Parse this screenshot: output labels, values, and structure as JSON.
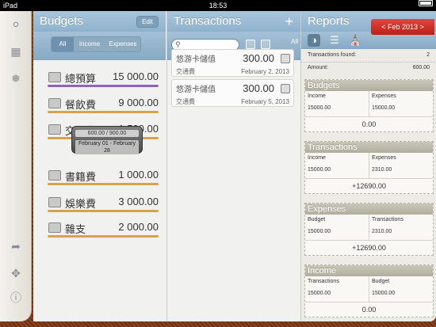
{
  "status": {
    "device": "iPad",
    "time": "18:53"
  },
  "sidebar": {
    "icons": [
      "lock-icon",
      "calculator-icon",
      "settings-icon",
      "share-icon",
      "magic-wand-icon",
      "info-icon"
    ]
  },
  "budgets": {
    "title": "Budgets",
    "edit": "Edit",
    "tabs": [
      "All",
      "Income",
      "Expenses"
    ],
    "items": [
      {
        "name": "總預算",
        "amount": "15 000.00",
        "color": "#8e62c4"
      },
      {
        "name": "餐飲費",
        "amount": "9 000.00",
        "color": "#d6a24a"
      },
      {
        "name": "交通費",
        "amount": "1 500.00",
        "color": "#d6a24a"
      },
      {
        "name": "書籍費",
        "amount": "1 000.00",
        "color": "#d6a24a"
      },
      {
        "name": "娛樂費",
        "amount": "3 000.00",
        "color": "#d6a24a"
      },
      {
        "name": "雜支",
        "amount": "2 000.00",
        "color": "#d6a24a"
      }
    ],
    "tooltip": {
      "used": "600.00 / 900.00",
      "range": "February 01 - February 28"
    }
  },
  "transactions": {
    "title": "Transactions",
    "all": "All",
    "items": [
      {
        "name": "悠游卡儲值",
        "category": "交通費",
        "amount": "300.00",
        "date": "February 2, 2013"
      },
      {
        "name": "悠游卡儲值",
        "category": "交通費",
        "amount": "300.00",
        "date": "February 5, 2013"
      }
    ]
  },
  "reports": {
    "title": "Reports",
    "period": "< Feb 2013 >",
    "found_label": "Transactions found:",
    "found": "2",
    "amount_label": "Amount:",
    "amount": "600.00",
    "sections": [
      {
        "title": "Budgets",
        "l1": "Income",
        "v1": "15000.00",
        "l2": "Expenses",
        "v2": "15000.00",
        "total": "0.00"
      },
      {
        "title": "Transactions",
        "l1": "Income",
        "v1": "15000.00",
        "l2": "Expenses",
        "v2": "2310.00",
        "total": "+12690.00"
      },
      {
        "title": "Expenses",
        "l1": "Budget",
        "v1": "15000.00",
        "l2": "Transactions",
        "v2": "2310.00",
        "total": "+12690.00"
      },
      {
        "title": "Income",
        "l1": "Transactions",
        "v1": "15000.00",
        "l2": "Budget",
        "v2": "15000.00",
        "total": "0.00"
      }
    ]
  }
}
